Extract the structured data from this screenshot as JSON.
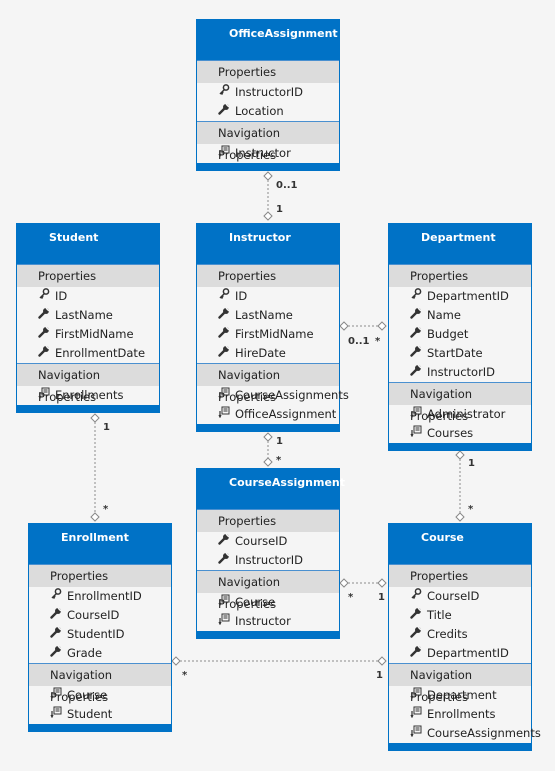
{
  "entities": [
    {
      "id": "office-assignment",
      "title": "OfficeAssignment",
      "properties_label": "Properties",
      "properties": [
        {
          "name": "InstructorID",
          "icon": "key-icon"
        },
        {
          "name": "Location",
          "icon": "wrench-icon"
        }
      ],
      "nav_label": "Navigation Properties",
      "navigation": [
        {
          "name": "Instructor",
          "icon": "navigation-property-icon"
        }
      ]
    },
    {
      "id": "student",
      "title": "Student",
      "properties_label": "Properties",
      "properties": [
        {
          "name": "ID",
          "icon": "key-icon"
        },
        {
          "name": "LastName",
          "icon": "wrench-icon"
        },
        {
          "name": "FirstMidName",
          "icon": "wrench-icon"
        },
        {
          "name": "EnrollmentDate",
          "icon": "wrench-icon"
        }
      ],
      "nav_label": "Navigation Properties",
      "navigation": [
        {
          "name": "Enrollments",
          "icon": "navigation-property-icon"
        }
      ]
    },
    {
      "id": "instructor",
      "title": "Instructor",
      "properties_label": "Properties",
      "properties": [
        {
          "name": "ID",
          "icon": "key-icon"
        },
        {
          "name": "LastName",
          "icon": "wrench-icon"
        },
        {
          "name": "FirstMidName",
          "icon": "wrench-icon"
        },
        {
          "name": "HireDate",
          "icon": "wrench-icon"
        }
      ],
      "nav_label": "Navigation Properties",
      "navigation": [
        {
          "name": "CourseAssignments",
          "icon": "navigation-property-icon"
        },
        {
          "name": "OfficeAssignment",
          "icon": "navigation-property-icon"
        }
      ]
    },
    {
      "id": "department",
      "title": "Department",
      "properties_label": "Properties",
      "properties": [
        {
          "name": "DepartmentID",
          "icon": "key-icon"
        },
        {
          "name": "Name",
          "icon": "wrench-icon"
        },
        {
          "name": "Budget",
          "icon": "wrench-icon"
        },
        {
          "name": "StartDate",
          "icon": "wrench-icon"
        },
        {
          "name": "InstructorID",
          "icon": "wrench-icon"
        }
      ],
      "nav_label": "Navigation Properties",
      "navigation": [
        {
          "name": "Administrator",
          "icon": "navigation-property-icon"
        },
        {
          "name": "Courses",
          "icon": "navigation-property-icon"
        }
      ]
    },
    {
      "id": "course-assignment",
      "title": "CourseAssignment",
      "properties_label": "Properties",
      "properties": [
        {
          "name": "CourseID",
          "icon": "wrench-icon"
        },
        {
          "name": "InstructorID",
          "icon": "wrench-icon"
        }
      ],
      "nav_label": "Navigation Properties",
      "navigation": [
        {
          "name": "Course",
          "icon": "navigation-property-icon"
        },
        {
          "name": "Instructor",
          "icon": "navigation-property-icon"
        }
      ]
    },
    {
      "id": "enrollment",
      "title": "Enrollment",
      "properties_label": "Properties",
      "properties": [
        {
          "name": "EnrollmentID",
          "icon": "key-icon"
        },
        {
          "name": "CourseID",
          "icon": "wrench-icon"
        },
        {
          "name": "StudentID",
          "icon": "wrench-icon"
        },
        {
          "name": "Grade",
          "icon": "wrench-icon"
        }
      ],
      "nav_label": "Navigation Properties",
      "navigation": [
        {
          "name": "Course",
          "icon": "navigation-property-icon"
        },
        {
          "name": "Student",
          "icon": "navigation-property-icon"
        }
      ]
    },
    {
      "id": "course",
      "title": "Course",
      "properties_label": "Properties",
      "properties": [
        {
          "name": "CourseID",
          "icon": "key-icon"
        },
        {
          "name": "Title",
          "icon": "wrench-icon"
        },
        {
          "name": "Credits",
          "icon": "wrench-icon"
        },
        {
          "name": "DepartmentID",
          "icon": "wrench-icon"
        }
      ],
      "nav_label": "Navigation Properties",
      "navigation": [
        {
          "name": "Department",
          "icon": "navigation-property-icon"
        },
        {
          "name": "Enrollments",
          "icon": "navigation-property-icon"
        },
        {
          "name": "CourseAssignments",
          "icon": "navigation-property-icon"
        }
      ]
    }
  ],
  "associations": [
    {
      "from": "office-assignment",
      "to": "instructor",
      "from_mult": "0..1",
      "to_mult": "1"
    },
    {
      "from": "student",
      "to": "enrollment",
      "from_mult": "1",
      "to_mult": "*"
    },
    {
      "from": "instructor",
      "to": "department",
      "from_mult": "0..1",
      "to_mult": "*"
    },
    {
      "from": "instructor",
      "to": "course-assignment",
      "from_mult": "1",
      "to_mult": "*"
    },
    {
      "from": "department",
      "to": "course",
      "from_mult": "1",
      "to_mult": "*"
    },
    {
      "from": "course-assignment",
      "to": "course",
      "from_mult": "*",
      "to_mult": "1"
    },
    {
      "from": "enrollment",
      "to": "course",
      "from_mult": "*",
      "to_mult": "1"
    }
  ],
  "colors": {
    "header": "#0072c6",
    "band": "#dcdcdc",
    "background": "#f5f5f5"
  }
}
